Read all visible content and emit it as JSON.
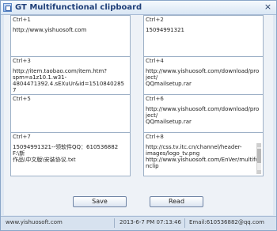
{
  "window": {
    "title": "GT  Multifunctional clipboard",
    "close_glyph": "×"
  },
  "panels": [
    {
      "label": "Ctrl+1",
      "text": "http://www.yishuosoft.com"
    },
    {
      "label": "Ctrl+2",
      "text": "15094991321"
    },
    {
      "label": "Ctrl+3",
      "text": "http://item.taobao.com/item.htm?\nspm=a1z10.1.w31-\n4804471392.4.sEXuUr&id=15108402857"
    },
    {
      "label": "Ctrl+4",
      "text": "http://www.yishuosoft.com/download/project/\nQQmailsetup.rar"
    },
    {
      "label": "Ctrl+5",
      "text": ""
    },
    {
      "label": "Ctrl+6",
      "text": "http://www.yishuosoft.com/download/project/\nQQmailsetup.rar"
    },
    {
      "label": "Ctrl+7",
      "text": "15094991321--领软件QQ：610536882F:\\新\n作品\\中文版\\安装协议.txt"
    },
    {
      "label": "Ctrl+8",
      "text": "http://css.tv.itc.cn/channel/header-\nimages/logo_tv.png\nhttp://www.yishuosoft.com/EnVer/multifunclip"
    }
  ],
  "buttons": {
    "save": "Save",
    "read": "Read"
  },
  "status": {
    "website": "www.yishuosoft.com",
    "datetime": "2013-6-7 PM 07:13:46",
    "email": "Email:610536882@qq.com"
  }
}
